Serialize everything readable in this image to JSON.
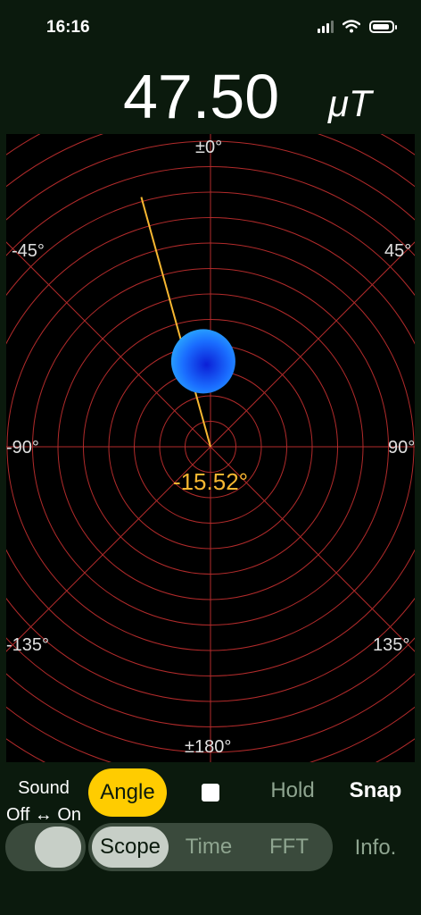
{
  "status": {
    "time": "16:16"
  },
  "readout": {
    "value": "47.50",
    "unit": "μT"
  },
  "scope": {
    "angle_reading": "-15.52°",
    "angle_degrees": -15.52,
    "labels": {
      "top": "±0°",
      "top_left": "-45°",
      "top_right": "45°",
      "left": "-90°",
      "right": "90°",
      "bottom_left": "-135°",
      "bottom_right": "135°",
      "bottom": "±180°"
    },
    "colors": {
      "grid": "#b22b2b",
      "needle": "#f7b731",
      "dot": "#1a6dff",
      "text": "#f7b731"
    }
  },
  "controls": {
    "sound_label_1": "Sound",
    "sound_label_2": "Off ↔ On",
    "angle": "Angle",
    "hold": "Hold",
    "snap": "Snap",
    "tabs": [
      {
        "label": "Scope",
        "selected": true
      },
      {
        "label": "Time",
        "selected": false
      },
      {
        "label": "FFT",
        "selected": false
      }
    ],
    "info": "Info."
  }
}
